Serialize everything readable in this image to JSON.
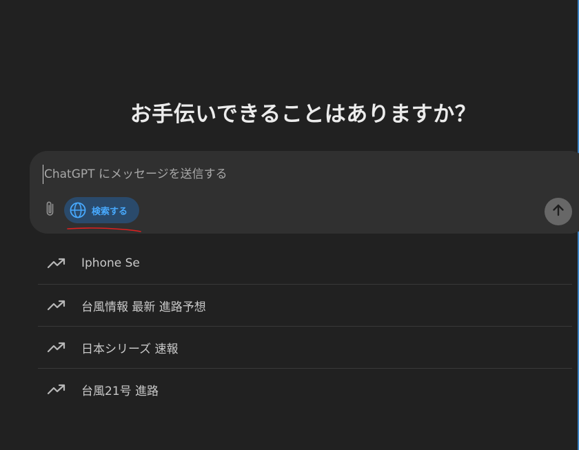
{
  "main": {
    "headline": "お手伝いできることはありますか？"
  },
  "composer": {
    "placeholder": "ChatGPT にメッセージを送信する",
    "search_label": "検索する",
    "icons": {
      "attach": "paperclip-icon",
      "search": "globe-icon",
      "send": "arrow-up-icon"
    }
  },
  "suggestions": [
    {
      "icon": "trending-up-icon",
      "label": "Iphone Se"
    },
    {
      "icon": "trending-up-icon",
      "label": "台風情報 最新 進路予想"
    },
    {
      "icon": "trending-up-icon",
      "label": "日本シリーズ 速報"
    },
    {
      "icon": "trending-up-icon",
      "label": "台風21号 進路"
    }
  ],
  "colors": {
    "background": "#212121",
    "composer": "#303030",
    "search_button_bg": "#2a4a6b",
    "search_button_text": "#48aaff",
    "send_button": "#676767",
    "annotation": "#e02020"
  }
}
